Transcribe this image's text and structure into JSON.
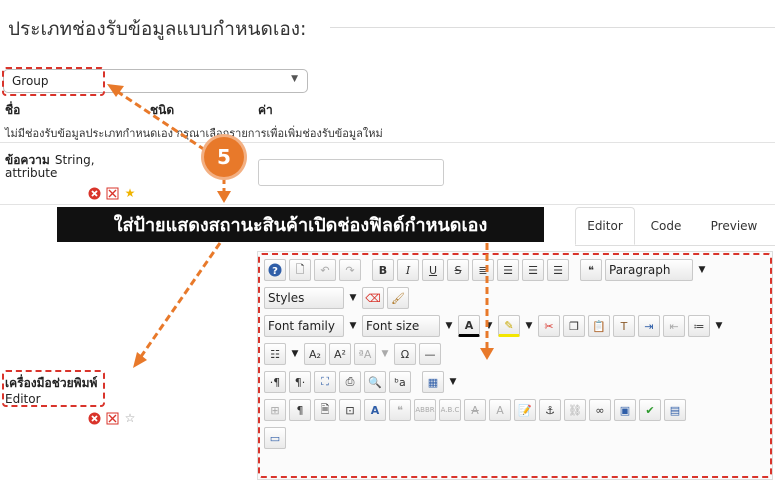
{
  "legend": "ประเภทช่องรับข้อมูลแบบกำหนดเอง:",
  "group_select": {
    "value": "Group"
  },
  "table_headers": {
    "name": "ชื่อ",
    "type": "ชนิด",
    "value": "ค่า"
  },
  "note": "ไม่มีช่องรับข้อมูลประเภทกำหนดเอง กรุณาเลือกรายการเพื่อเพิ่มช่องรับข้อมูลใหม่",
  "field1": {
    "label": "ข้อความ",
    "type_line1": "String,",
    "type_line2": "attribute"
  },
  "field2": {
    "label": "เครื่องมือช่วยพิมพ์",
    "type": "Editor"
  },
  "banner": "ใส่ป้ายแสดงสถานะสินค้าเปิดช่องฟิลด์กำหนดเอง",
  "step_number": "5",
  "tabs": {
    "editor": "Editor",
    "code": "Code",
    "preview": "Preview"
  },
  "toolbar": {
    "paragraph": "Paragraph",
    "styles": "Styles",
    "font_family": "Font family",
    "font_size": "Font size"
  },
  "colors": {
    "accent_red": "#d9342b",
    "orange": "#e8792a",
    "banner_bg": "#111111"
  },
  "icons": [
    "help-icon",
    "new-document-icon",
    "undo-icon",
    "redo-icon",
    "bold-icon",
    "italic-icon",
    "underline-icon",
    "strikethrough-icon",
    "align-justify-icon",
    "align-center-icon",
    "align-left-icon",
    "align-right-icon",
    "blockquote-icon",
    "eraser-icon",
    "brush-icon",
    "text-color-icon",
    "highlight-icon",
    "cut-icon",
    "copy-icon",
    "paste-icon",
    "paste-text-icon",
    "indent-icon",
    "outdent-icon",
    "numbered-list-icon",
    "bullet-list-icon",
    "subscript-icon",
    "superscript-icon",
    "omega-icon",
    "horizontal-rule-icon",
    "ltr-icon",
    "rtl-icon",
    "fullscreen-icon",
    "print-icon",
    "find-icon",
    "replace-icon",
    "table-icon",
    "star-icon",
    "delete-icon",
    "move-icon"
  ]
}
